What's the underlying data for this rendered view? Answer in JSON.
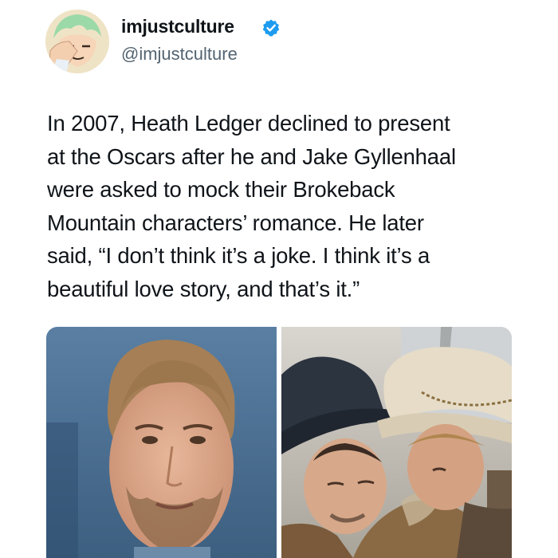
{
  "account": {
    "display_name": "imjustculture",
    "handle": "@imjustculture",
    "verified": true,
    "verified_color": "#1d9bf0",
    "avatar_icon": "anime-character-facepalm-avatar"
  },
  "tweet": {
    "text": "In 2007, Heath Ledger declined to present\nat the Oscars after he and Jake Gyllenhaal\nwere asked to mock their Brokeback\nMountain characters’ romance. He later\nsaid, “I don’t think it’s a joke. I think it’s a\nbeautiful love story, and that’s it.”"
  },
  "media": {
    "photos": [
      {
        "subject": "portrait-photo",
        "background": "#4a6f93"
      },
      {
        "subject": "film-still-two-men-in-cowboy-hats",
        "background": "#c9c6c0"
      }
    ]
  }
}
